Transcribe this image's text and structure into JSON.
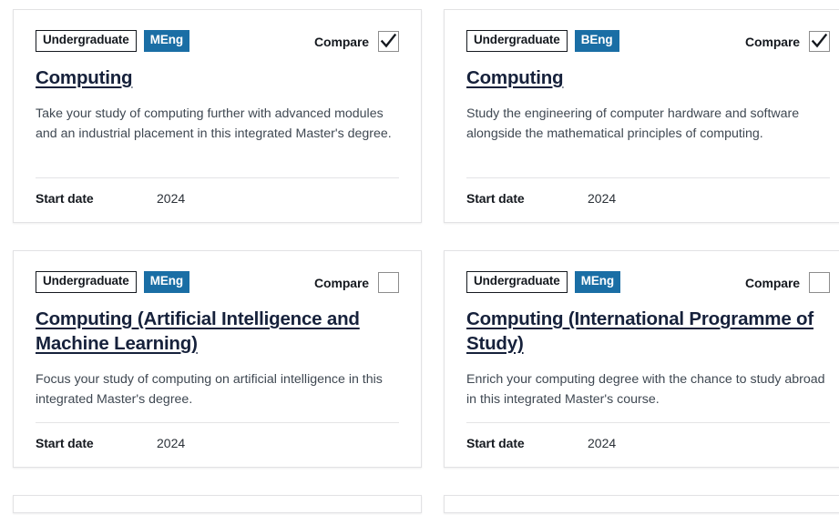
{
  "labels": {
    "compare": "Compare",
    "start_date_label": "Start date"
  },
  "colors": {
    "badge_blue": "#1a6ea5",
    "title_navy": "#16213b",
    "body_grey": "#3f4852",
    "card_border": "#e2e2e4"
  },
  "cards": [
    {
      "level": "Undergraduate",
      "award": "MEng",
      "title": "Computing",
      "description": "Take your study of computing further with advanced modules and an industrial placement in this integrated Master's degree.",
      "start_date_label": "Start date",
      "start_date_value": "2024",
      "compare_label": "Compare",
      "compare_checked": true
    },
    {
      "level": "Undergraduate",
      "award": "BEng",
      "title": "Computing",
      "description": "Study the engineering of computer hardware and software alongside the mathematical principles of computing.",
      "start_date_label": "Start date",
      "start_date_value": "2024",
      "compare_label": "Compare",
      "compare_checked": true
    },
    {
      "level": "Undergraduate",
      "award": "MEng",
      "title": "Computing (Artificial Intelligence and Machine Learning)",
      "description": "Focus your study of computing on artificial intelligence in this integrated Master's degree.",
      "start_date_label": "Start date",
      "start_date_value": "2024",
      "compare_label": "Compare",
      "compare_checked": false
    },
    {
      "level": "Undergraduate",
      "award": "MEng",
      "title": "Computing (International Programme of Study)",
      "description": "Enrich your computing degree with the chance to study abroad in this integrated Master's course.",
      "start_date_label": "Start date",
      "start_date_value": "2024",
      "compare_label": "Compare",
      "compare_checked": false
    }
  ]
}
